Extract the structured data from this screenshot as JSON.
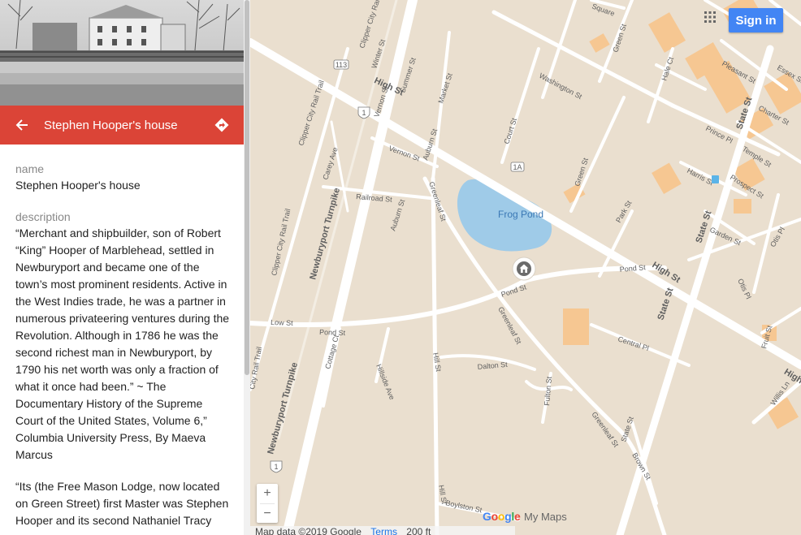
{
  "panel": {
    "title": "Stephen Hooper's house",
    "name_label": "name",
    "name_value": "Stephen Hooper's house",
    "description_label": "description",
    "description_paragraphs": [
      "“Merchant and shipbuilder, son of Robert “King” Hooper of Marblehead, settled in Newburyport and became one of the town’s most prominent residents. Active in the West Indies trade, he was a partner in numerous privateering ventures during the Revolution. Although in 1786 he was the second richest man in Newburyport, by 1790 his net worth was only a fraction of what it once had been.” ~ The Documentary History of the Supreme Court of the United States, Volume 6,” Columbia University Press, By Maeva Marcus",
      "“Its (the Free Mason Lodge, now located on Green Street) first Master was Stephen Hooper and its second Nathaniel Tracy"
    ],
    "back_icon": "arrow-left-icon",
    "directions_icon": "directions-icon"
  },
  "map": {
    "water_label": "Frog Pond",
    "streets": {
      "high_st_1": "High St",
      "high_st_2": "High St",
      "high_st_3": "High",
      "state_st_1": "State St",
      "state_st_2": "State St",
      "state_st_3": "State St",
      "newburyport_tpk_1": "Newburyport Turnpike",
      "newburyport_tpk_2": "Newburyport Turnpike",
      "clipper_city_1": "Clipper City Rail Trail",
      "clipper_city_2": "Clipper City Rail Trail",
      "clipper_city_3": "Clipper City Rail Trail",
      "clipper_city_4": "City Rail Trail",
      "carey_ave": "Carey Ave",
      "vernon_st_1": "Vernon St",
      "vernon_st_2": "Vernon St",
      "railroad_st": "Railroad St",
      "auburn_st_1": "Auburn St",
      "auburn_st_2": "Auburn St",
      "summer_st": "Summer St",
      "winter_st": "Winter St",
      "market_st": "Market St",
      "greenleaf_st_1": "Greenleaf St",
      "greenleaf_st_2": "Greenleaf St",
      "greenleaf_st_3": "Greenleaf St",
      "court_st": "Court St",
      "washington_st": "Washington St",
      "green_st_1": "Green St",
      "green_st_2": "Green St",
      "pond_st_1": "Pond St",
      "pond_st_2": "Pond St",
      "pond_st_3": "Pond St",
      "low_st": "Low St",
      "cottage_ct": "Cottage Ct",
      "hillside_ave": "Hillside Ave",
      "hill_st_1": "Hill St",
      "hill_st_2": "Hill St",
      "dalton_st": "Dalton St",
      "fulton_st": "Fulton St",
      "boylston_st": "Boylston St",
      "park_st": "Park St",
      "harris_st": "Harris St",
      "prince_pl": "Prince Pl",
      "temple_st": "Temple St",
      "prospect_st": "Prospect St",
      "garden_st": "Garden St",
      "otis_pl_1": "Otis Pl",
      "otis_pl_2": "Otis Pl",
      "central_pl": "Central Pl",
      "fruit_st": "Fruit St",
      "brown_st": "Brown St",
      "charter_st": "Charter St",
      "pleasant_st": "Pleasant St",
      "essex_st": "Essex St",
      "hale_ct": "Hale Ct",
      "willis_ln": "Willis Ln",
      "square": "Square",
      "route_113": "113",
      "route_1a": "1A",
      "route_1": "1",
      "route_1b": "1"
    }
  },
  "controls": {
    "sign_in_label": "Sign in",
    "zoom_in_label": "+",
    "zoom_out_label": "−",
    "apps_icon": "grid-apps-icon"
  },
  "branding": {
    "google_letters": [
      "G",
      "o",
      "o",
      "g",
      "l",
      "e"
    ],
    "my_maps": "My Maps"
  },
  "attribution": {
    "map_data": "Map data ©2019 Google",
    "terms": "Terms",
    "scale": "200 ft"
  },
  "colors": {
    "header_red": "#db4437",
    "signin_blue": "#4285f4",
    "pond_blue": "#9fcbe8",
    "map_land": "#eadfcf",
    "road_white": "#ffffff",
    "building_orange": "#f6c792"
  }
}
